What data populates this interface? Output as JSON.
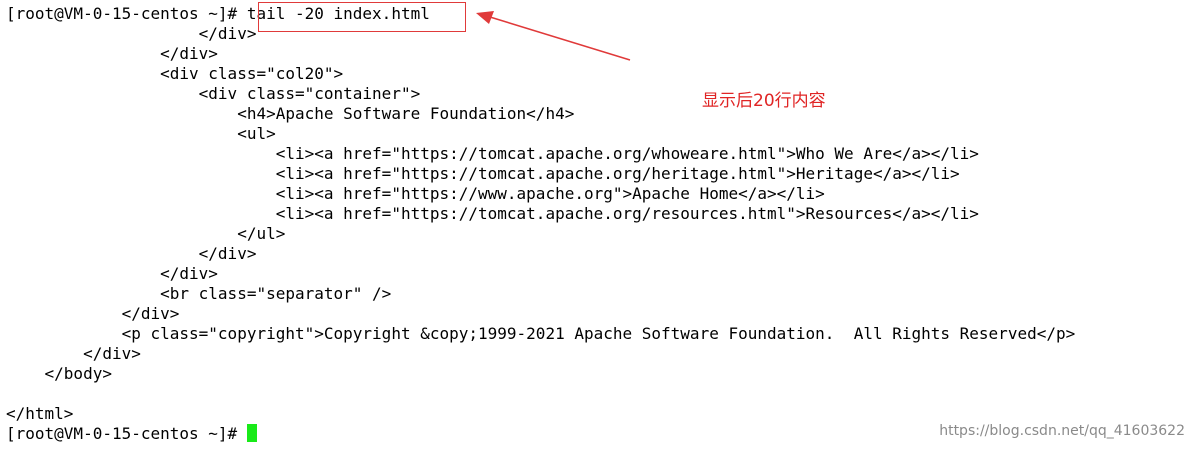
{
  "terminal": {
    "lines": [
      "[root@VM-0-15-centos ~]# tail -20 index.html",
      "                    </div>",
      "                </div>",
      "                <div class=\"col20\">",
      "                    <div class=\"container\">",
      "                        <h4>Apache Software Foundation</h4>",
      "                        <ul>",
      "                            <li><a href=\"https://tomcat.apache.org/whoweare.html\">Who We Are</a></li>",
      "                            <li><a href=\"https://tomcat.apache.org/heritage.html\">Heritage</a></li>",
      "                            <li><a href=\"https://www.apache.org\">Apache Home</a></li>",
      "                            <li><a href=\"https://tomcat.apache.org/resources.html\">Resources</a></li>",
      "                        </ul>",
      "                    </div>",
      "                </div>",
      "                <br class=\"separator\" />",
      "            </div>",
      "            <p class=\"copyright\">Copyright &copy;1999-2021 Apache Software Foundation.  All Rights Reserved</p>",
      "        </div>",
      "    </body>",
      "",
      "</html>"
    ],
    "prompt": "[root@VM-0-15-centos ~]# ",
    "cursor_color": "#19ea19"
  },
  "annotation": {
    "text": "显示后20行内容",
    "color": "#e02525"
  },
  "watermark": {
    "text": "https://blog.csdn.net/qq_41603622"
  }
}
